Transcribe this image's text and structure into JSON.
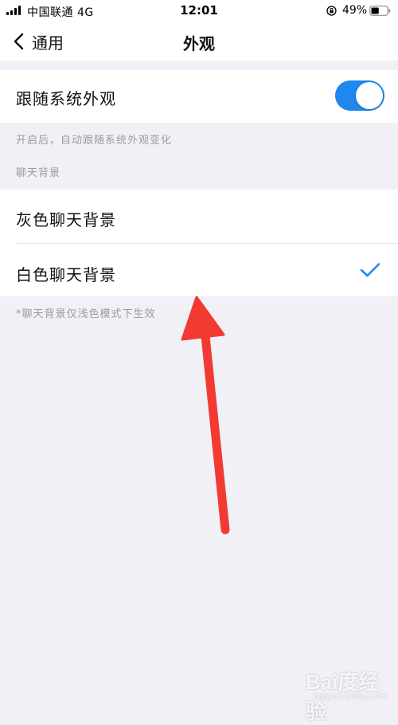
{
  "status_bar": {
    "carrier": "中国联通  4G",
    "time": "12:01",
    "battery_percent": "49%",
    "battery_level": 0.49,
    "signal_bars": 4
  },
  "nav": {
    "back_label": "通用",
    "title": "外观"
  },
  "follow_system": {
    "label": "跟随系统外观",
    "enabled": true,
    "hint": "开启后，自动跟随系统外观变化"
  },
  "chat_background": {
    "section_header": "聊天背景",
    "options": [
      {
        "label": "灰色聊天背景",
        "selected": false
      },
      {
        "label": "白色聊天背景",
        "selected": true
      }
    ],
    "footer_hint": "*聊天背景仅浅色模式下生效"
  },
  "watermark": {
    "logo": "Bai度经验",
    "url": "jingyan.baidu.com"
  },
  "colors": {
    "accent": "#1f87ee",
    "annotation": "#f23a32",
    "background": "#f0f0f6",
    "hint_text": "#9a9aa2"
  }
}
